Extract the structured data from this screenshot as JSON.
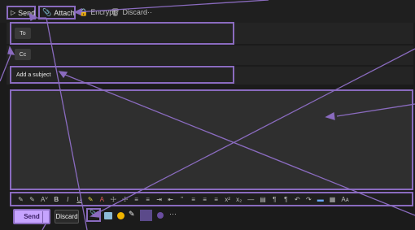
{
  "toolbar": {
    "send_label": "Send",
    "attach_label": "Attach",
    "encrypt_label": "Encrypt",
    "discard_label": "Discard",
    "more_label": "···"
  },
  "recipients": {
    "to_label": "To",
    "cc_label": "Cc"
  },
  "subject": {
    "placeholder": "Add a subject"
  },
  "format_toolbar": {
    "items": [
      "✎",
      "✎",
      "Aⱽ",
      "B",
      "I",
      "U",
      "✎",
      "A",
      "☩",
      "☩",
      "≡",
      "≡",
      "⇥",
      "⇤",
      "”",
      "≡",
      "≡",
      "≡",
      "x²",
      "x₂",
      "—",
      "▤",
      "¶",
      "¶",
      "↶",
      "↷",
      "▬",
      "▦",
      "Aᴀ"
    ]
  },
  "bottom_bar": {
    "send_label": "Send",
    "discard_label": "Discard",
    "more_label": "···"
  },
  "colors": {
    "highlight": "#8a6bbf",
    "send_bg": "#c6a4ff"
  }
}
